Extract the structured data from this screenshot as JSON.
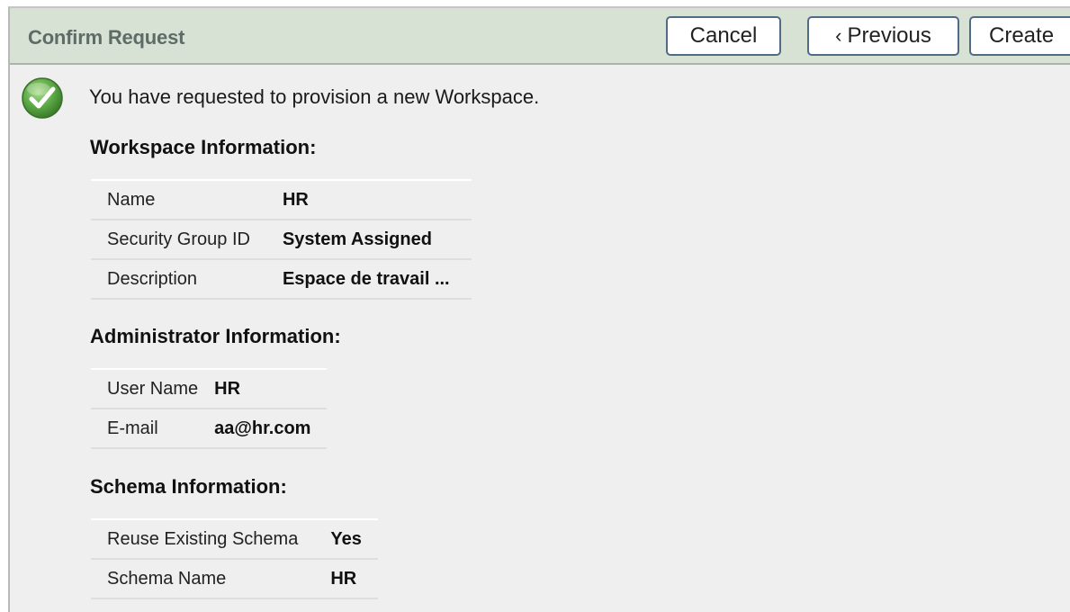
{
  "header": {
    "title": "Confirm Request",
    "buttons": {
      "cancel": "Cancel",
      "previous": "Previous",
      "create": "Create"
    }
  },
  "message": "You have requested to provision a new Workspace.",
  "sections": {
    "workspace": {
      "title": "Workspace Information:",
      "rows": [
        {
          "label": "Name",
          "value": "HR"
        },
        {
          "label": "Security Group ID",
          "value": "System Assigned"
        },
        {
          "label": "Description",
          "value": "Espace de travail ..."
        }
      ]
    },
    "administrator": {
      "title": "Administrator Information:",
      "rows": [
        {
          "label": "User Name",
          "value": "HR"
        },
        {
          "label": "E-mail",
          "value": "aa@hr.com"
        }
      ]
    },
    "schema": {
      "title": "Schema Information:",
      "rows": [
        {
          "label": "Reuse Existing Schema",
          "value": "Yes"
        },
        {
          "label": "Schema Name",
          "value": "HR"
        }
      ]
    }
  },
  "icons": {
    "status": "check-circle-icon",
    "previous": "chevron-left-icon"
  },
  "colors": {
    "header_bg": "#d7e2d5",
    "header_title": "#5d6c66",
    "button_border": "#4f6b86",
    "check_green": "#4c9a3a",
    "page_bg": "#efefef"
  }
}
